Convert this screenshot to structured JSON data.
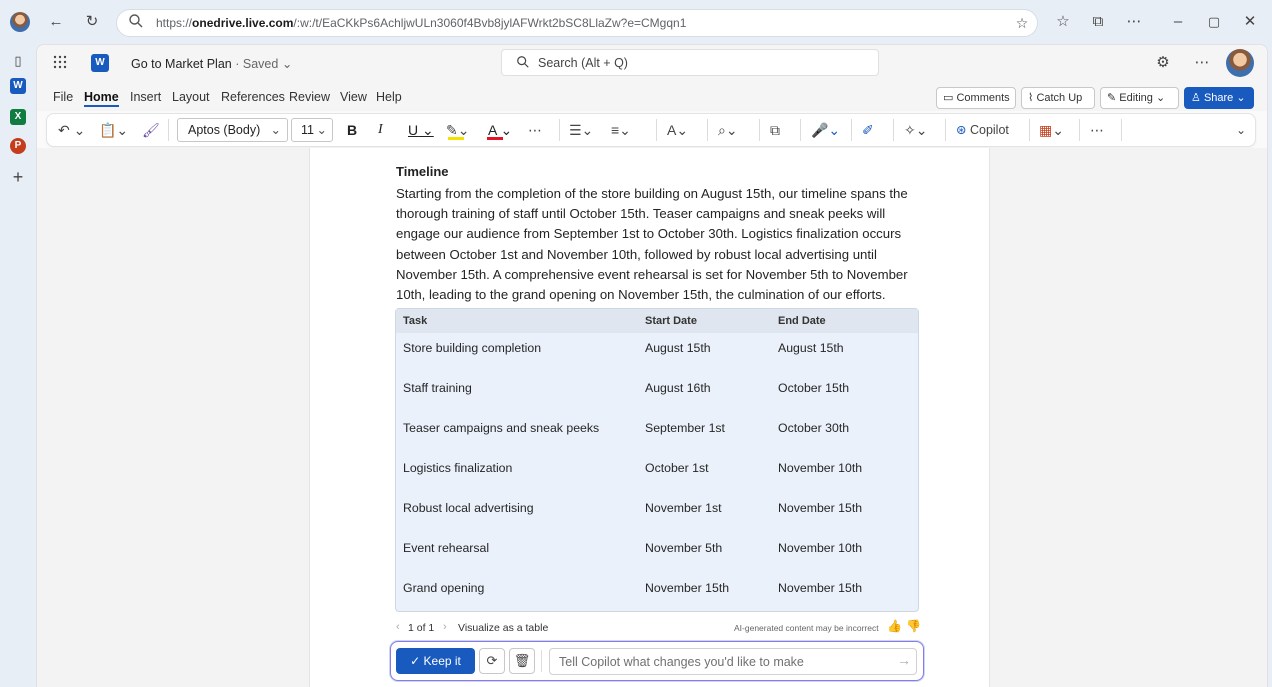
{
  "browser": {
    "url_prefix": "https://",
    "url_domain": "onedrive.live.com",
    "url_rest": "/:w:/t/EaCKkPs6AchljwULn3060f4Bvb8jylAFWrkt2bSC8LlaZw?e=CMgqn1"
  },
  "header": {
    "doc_title": "Go to Market Plan",
    "saved_status": "· Saved",
    "search_placeholder": "Search (Alt + Q)"
  },
  "menu": {
    "items": [
      "File",
      "Home",
      "Insert",
      "Layout",
      "References",
      "Review",
      "View",
      "Help"
    ],
    "comments": "Comments",
    "catch_up": "Catch Up",
    "editing": "Editing",
    "share": "Share"
  },
  "ribbon": {
    "font": "Aptos (Body)",
    "size": "11",
    "bold": "B",
    "italic": "I",
    "underline": "U",
    "font_color": "A",
    "copilot": "Copilot"
  },
  "document": {
    "heading": "Timeline",
    "body": "Starting from the completion of the store building on August 15th, our timeline spans the thorough training of staff until October 15th. Teaser campaigns and sneak peeks will engage our audience from September 1st to October 30th. Logistics finalization occurs between October 1st and November 10th, followed by robust local advertising until November 15th. A comprehensive event rehearsal is set for November 5th to November 10th, leading to the grand opening on November 15th, the culmination of our efforts.",
    "table": {
      "headers": [
        "Task",
        "Start Date",
        "End Date"
      ],
      "rows": [
        [
          "Store building completion",
          "August 15th",
          "August 15th"
        ],
        [
          "Staff training",
          "August 16th",
          "October 15th"
        ],
        [
          "Teaser campaigns and sneak peeks",
          "September 1st",
          "October 30th"
        ],
        [
          "Logistics finalization",
          "October 1st",
          "November 10th"
        ],
        [
          "Robust local advertising",
          "November 1st",
          "November 15th"
        ],
        [
          "Event rehearsal",
          "November 5th",
          "November 10th"
        ],
        [
          "Grand opening",
          "November 15th",
          "November 15th"
        ]
      ]
    }
  },
  "copilot": {
    "pager": "1 of 1",
    "visualize": "Visualize as a table",
    "disclaimer": "AI-generated content may be incorrect",
    "keep": "Keep it",
    "placeholder": "Tell Copilot what changes you'd like to make"
  },
  "colors": {
    "accent": "#185abd",
    "table_bg": "#eaf1fb",
    "highlight": "#f5e100",
    "font_color_bar": "#e81123"
  },
  "icons": [
    "refresh-icon",
    "back-icon",
    "search-icon",
    "star-icon",
    "favorites-icon",
    "collections-icon",
    "more-icon",
    "minimize-icon",
    "maximize-icon",
    "close-icon",
    "waffle-icon",
    "word-icon",
    "excel-icon",
    "powerpoint-icon",
    "settings-icon",
    "undo-icon",
    "paste-icon",
    "format-painter-icon",
    "highlighter-icon",
    "bullets-icon",
    "align-icon",
    "styles-icon",
    "find-icon",
    "dictate-icon",
    "editor-icon",
    "designer-icon",
    "copilot-icon",
    "apps-icon",
    "thumbs-up-icon",
    "thumbs-down-icon",
    "regenerate-icon",
    "delete-icon",
    "send-icon"
  ]
}
